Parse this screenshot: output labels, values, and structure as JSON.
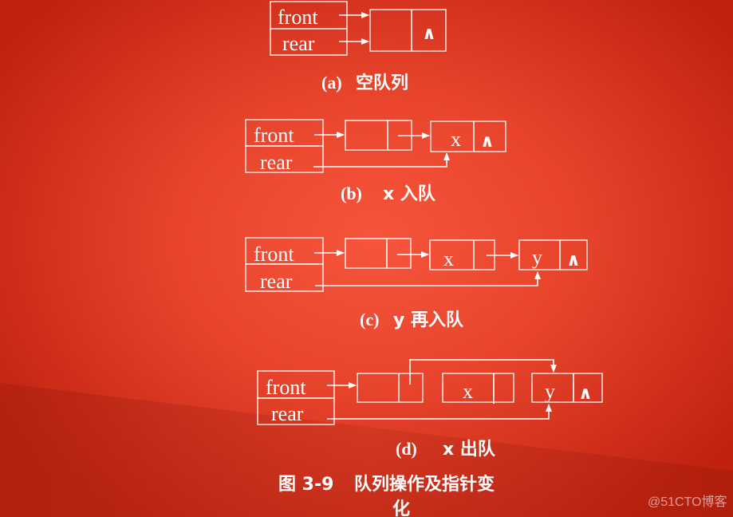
{
  "figure": {
    "title_prefix": "图 3-9",
    "title_main": "队列操作及指针变",
    "title_wrap": "化",
    "pointer_labels": {
      "front": "front",
      "rear": "rear"
    },
    "null_symbol": "∧",
    "panels": [
      {
        "id": "a",
        "caption_tag": "(a)",
        "caption_text": "空队列",
        "nodes": [
          {
            "value": "",
            "next": "∧"
          }
        ]
      },
      {
        "id": "b",
        "caption_tag": "(b)",
        "caption_text": "x 入队",
        "nodes": [
          {
            "value": "",
            "next": ""
          },
          {
            "value": "x",
            "next": "∧"
          }
        ]
      },
      {
        "id": "c",
        "caption_tag": "(c)",
        "caption_text": "y 再入队",
        "nodes": [
          {
            "value": "",
            "next": ""
          },
          {
            "value": "x",
            "next": ""
          },
          {
            "value": "y",
            "next": "∧"
          }
        ]
      },
      {
        "id": "d",
        "caption_tag": "(d)",
        "caption_text": "x 出队",
        "nodes": [
          {
            "value": "",
            "next": ""
          },
          {
            "value": "x",
            "next": ""
          },
          {
            "value": "y",
            "next": "∧"
          }
        ]
      }
    ]
  },
  "watermark": "@51CTO博客",
  "colors": {
    "background": "#e8442c",
    "foreground": "#ffffff"
  }
}
